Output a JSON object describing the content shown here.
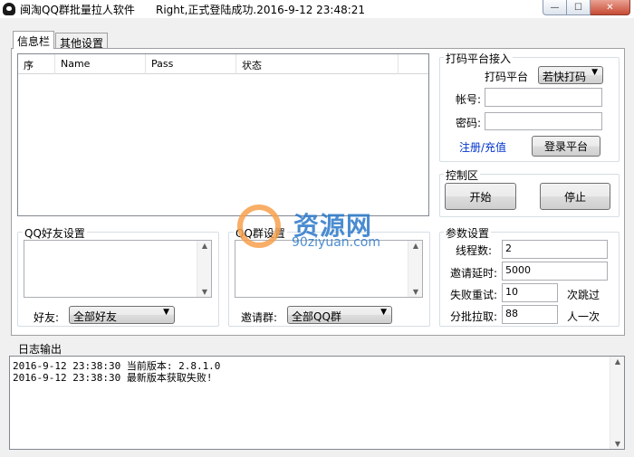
{
  "window": {
    "title": "闽淘QQ群批量拉人软件",
    "status": "Right,正式登陆成功.2016-9-12 23:48:21",
    "minimize_glyph": "—",
    "maximize_glyph": "☐",
    "close_glyph": "✕"
  },
  "tabs": [
    {
      "label": "信息栏",
      "active": true
    },
    {
      "label": "其他设置",
      "active": false
    }
  ],
  "table": {
    "columns": [
      "序",
      "Name",
      "Pass",
      "状态"
    ],
    "rows": []
  },
  "captcha": {
    "group_title": "打码平台接入",
    "platform_label": "打码平台",
    "platform_value": "若快打码",
    "account_label": "帐号:",
    "account_value": "",
    "password_label": "密码:",
    "password_value": "",
    "register_link": "注册/充值",
    "login_button": "登录平台"
  },
  "control": {
    "group_title": "控制区",
    "start_button": "开始",
    "stop_button": "停止"
  },
  "friends": {
    "group_title": "QQ好友设置",
    "friend_label": "好友:",
    "friend_value": "全部好友"
  },
  "groups": {
    "group_title": "QQ群设置",
    "invite_label": "邀请群:",
    "invite_value": "全部QQ群"
  },
  "params": {
    "group_title": "参数设置",
    "threads_label": "线程数:",
    "threads_value": "2",
    "delay_label": "邀请延时:",
    "delay_value": "5000",
    "retry_label": "失败重试:",
    "retry_value": "10",
    "retry_suffix": "次跳过",
    "batch_label": "分批拉取:",
    "batch_value": "88",
    "batch_suffix": "人一次"
  },
  "watermark": {
    "text": "资源网",
    "sub": "90ziyuan.com"
  },
  "log": {
    "title": "日志输出",
    "lines": [
      "2016-9-12 23:38:30 当前版本: 2.8.1.0",
      "2016-9-12 23:38:30 最新版本获取失败!"
    ]
  },
  "colors": {
    "link": "#0033cc",
    "watermark_blue": "#2b78c9",
    "watermark_orange": "#f7a14d"
  }
}
